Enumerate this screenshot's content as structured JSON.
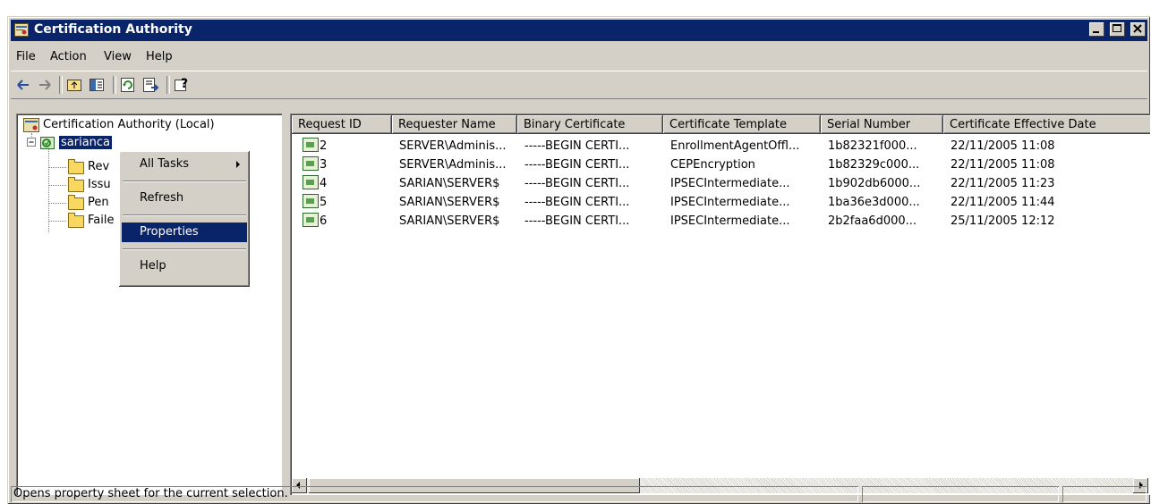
{
  "window": {
    "title": "Certification Authority"
  },
  "menu": {
    "items": [
      "File",
      "Action",
      "View",
      "Help"
    ]
  },
  "toolbar": {
    "buttons": [
      "back-icon",
      "forward-icon",
      "up-folder-icon",
      "show-hide-tree-icon",
      "refresh-icon",
      "export-list-icon",
      "help-icon"
    ]
  },
  "tree": {
    "root": "Certification Authority (Local)",
    "ca_name": "sarianca",
    "children": [
      "Rev",
      "Issu",
      "Pen",
      "Faile"
    ]
  },
  "context_menu": {
    "items": [
      {
        "label": "All Tasks",
        "submenu": true
      },
      {
        "label": "Refresh"
      },
      {
        "label": "Properties",
        "active": true
      },
      {
        "label": "Help"
      }
    ]
  },
  "list": {
    "columns": [
      "Request ID",
      "Requester Name",
      "Binary Certificate",
      "Certificate Template",
      "Serial Number",
      "Certificate Effective Date"
    ],
    "rows": [
      [
        "2",
        "SERVER\\Adminis...",
        "-----BEGIN CERTI...",
        "EnrollmentAgentOffl...",
        "1b82321f000...",
        "22/11/2005 11:08"
      ],
      [
        "3",
        "SERVER\\Adminis...",
        "-----BEGIN CERTI...",
        "CEPEncryption",
        "1b82329c000...",
        "22/11/2005 11:08"
      ],
      [
        "4",
        "SARIAN\\SERVER$",
        "-----BEGIN CERTI...",
        "IPSECIntermediate...",
        "1b902db6000...",
        "22/11/2005 11:23"
      ],
      [
        "5",
        "SARIAN\\SERVER$",
        "-----BEGIN CERTI...",
        "IPSECIntermediate...",
        "1ba36e3d000...",
        "22/11/2005 11:44"
      ],
      [
        "6",
        "SARIAN\\SERVER$",
        "-----BEGIN CERTI...",
        "IPSECIntermediate...",
        "2b2faa6d000...",
        "25/11/2005 12:12"
      ]
    ]
  },
  "status": {
    "text": "Opens property sheet for the current selection."
  },
  "colors": {
    "titlebar": "#0a246a",
    "face": "#d4d0c8",
    "highlight": "#0a246a"
  }
}
